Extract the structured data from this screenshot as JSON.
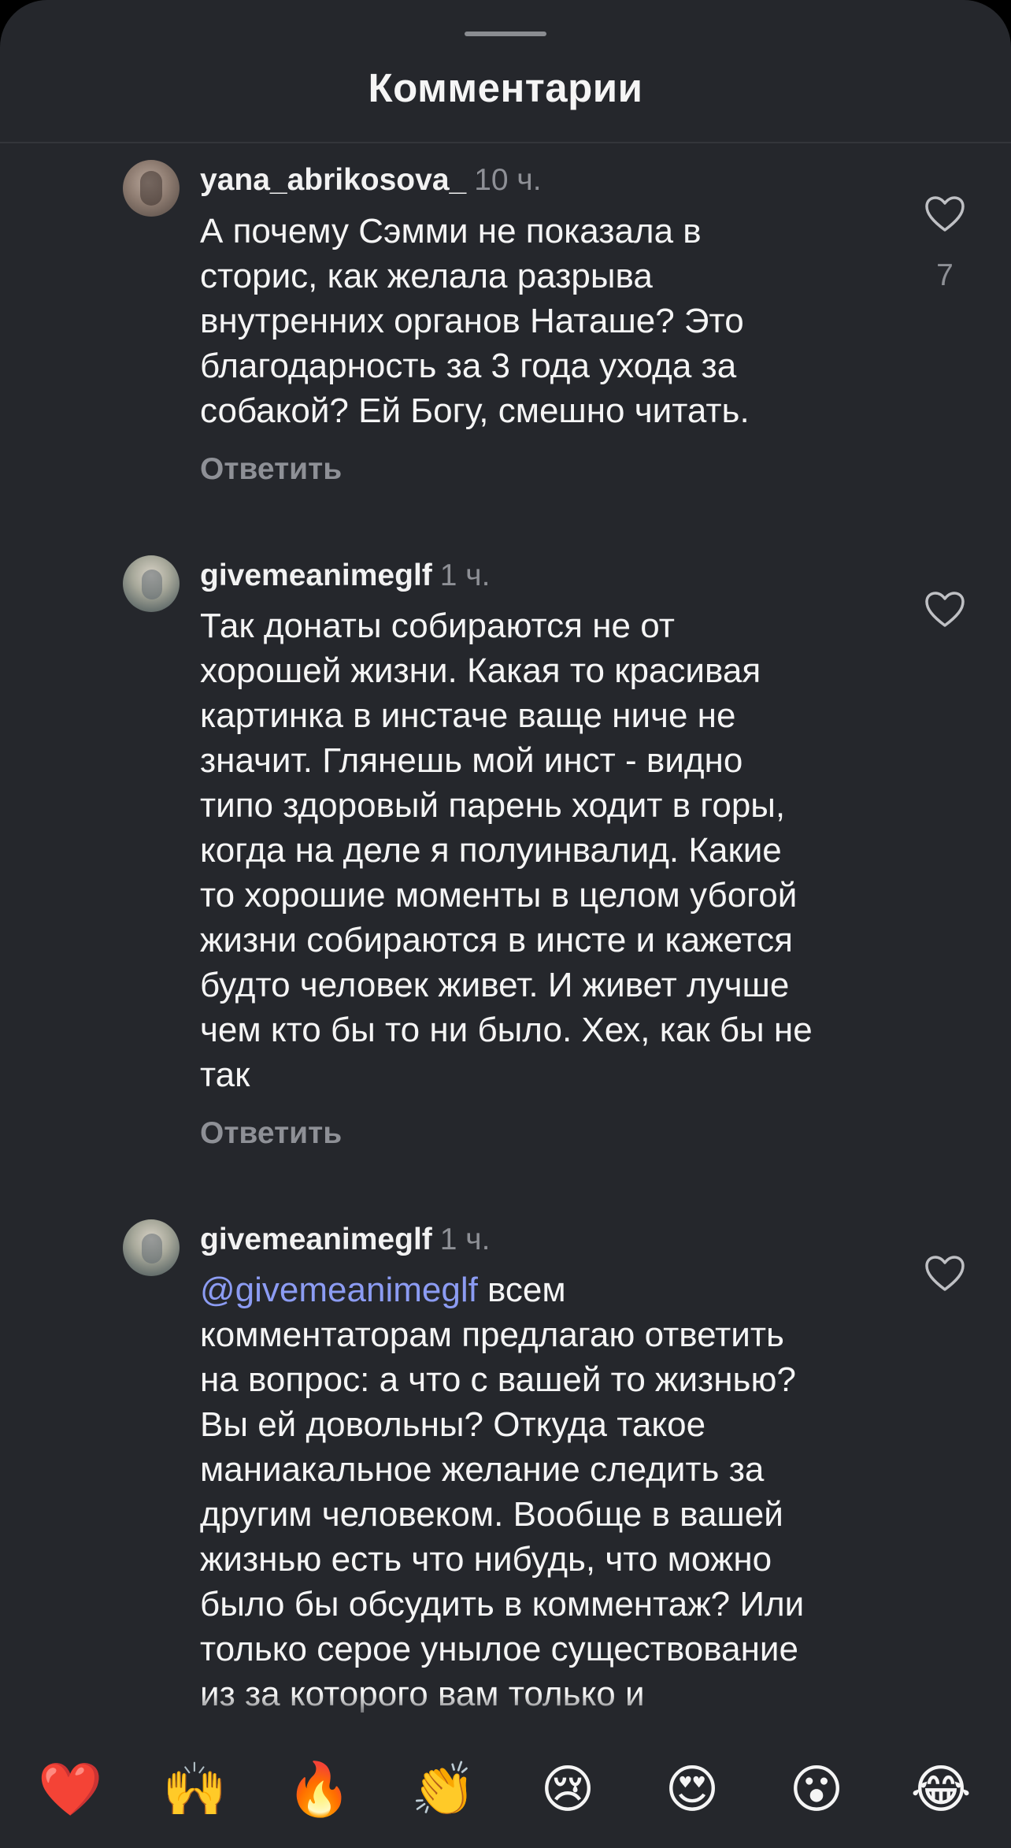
{
  "sheet": {
    "title": "Комментарии"
  },
  "comments": [
    {
      "username": "yana_abrikosova_",
      "time": "10 ч.",
      "mention": "",
      "text": "А почему Сэмми не показала в\nсторис, как желала разрыва\nвнутренних органов Наташе? Это\nблагодарность за 3 года ухода за\nсобакой? Ей Богу, смешно читать.",
      "reply_label": "Ответить",
      "likes": "7",
      "avatar": "avatar-photo"
    },
    {
      "username": "givemeanimeglf",
      "time": "1 ч.",
      "mention": "",
      "text": "Так донаты собираются не от\nхорошей жизни. Какая то красивая\nкартинка в инстаче ваще ниче не\nзначит. Глянешь мой инст - видно\nтипо здоровый парень ходит в горы,\nкогда на деле я полуинвалид. Какие\nто хорошие моменты в целом убогой\nжизни собираются в инсте и кажется\nбудто человек живет. И живет лучше\nчем кто бы то ни было. Хех, как бы не\nтак",
      "reply_label": "Ответить",
      "likes": "",
      "avatar": "avatar-photo"
    },
    {
      "username": "givemeanimeglf",
      "time": "1 ч.",
      "mention": "@givemeanimeglf",
      "text": " всем\nкомментаторам предлагаю ответить\nна вопрос: а что с вашей то жизнью?\nВы ей довольны? Откуда такое\nманиакальное желание следить за\nдругим человеком. Вообще в вашей\nжизнью есть что нибудь, что можно\nбыло бы обсудить в комментаж? Или\nтолько серое унылое существование\nиз за которого вам только и\nостается, что следить, да обсуждать",
      "reply_label": "",
      "likes": "",
      "avatar": "avatar-photo"
    }
  ],
  "reactions": [
    {
      "emoji": "❤️",
      "name": "red-heart"
    },
    {
      "emoji": "🙌",
      "name": "raising-hands"
    },
    {
      "emoji": "🔥",
      "name": "fire"
    },
    {
      "emoji": "👏",
      "name": "clapping-hands"
    },
    {
      "emoji": "😢",
      "name": "crying-face"
    },
    {
      "emoji": "😍",
      "name": "heart-eyes"
    },
    {
      "emoji": "😮",
      "name": "surprised-face"
    },
    {
      "emoji": "😂",
      "name": "tears-of-joy"
    }
  ],
  "colors": {
    "background": "#25272c",
    "text": "#f5f5f5",
    "secondary": "#8e9096",
    "mention": "#8c9cf3"
  }
}
